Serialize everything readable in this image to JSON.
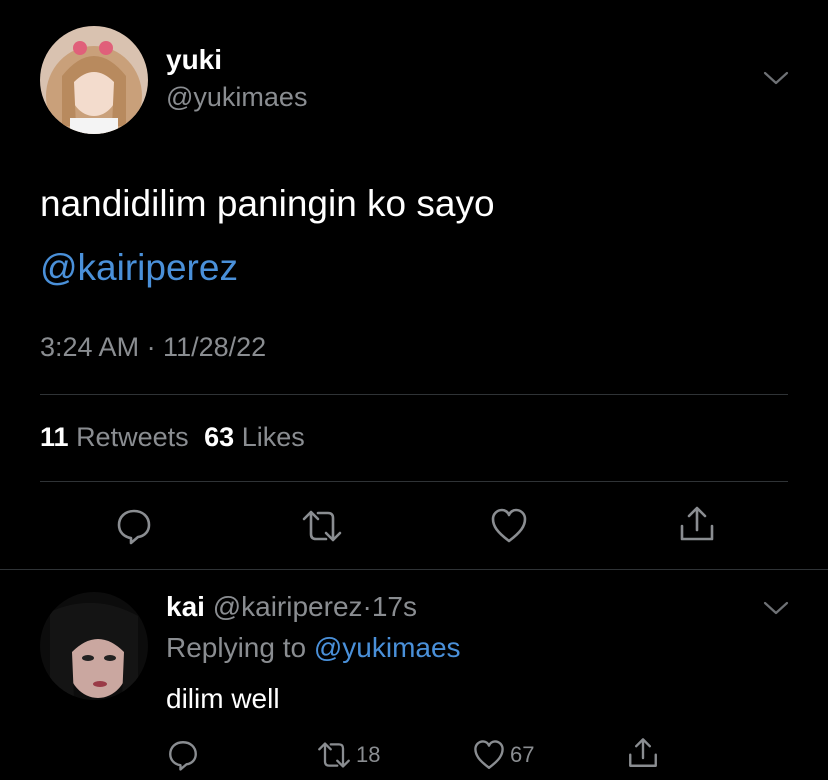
{
  "tweet": {
    "display_name": "yuki",
    "handle": "@yukimaes",
    "text_line1": "nandidilim paningin ko sayo",
    "text_mention": "@kairiperez",
    "timestamp": "3:24 AM · 11/28/22",
    "retweets_count": "11",
    "retweets_label": "Retweets",
    "likes_count": "63",
    "likes_label": "Likes",
    "actions": [
      "reply-icon",
      "retweet-icon",
      "like-icon",
      "share-icon"
    ]
  },
  "reply": {
    "display_name": "kai",
    "handle": "@kairiperez",
    "separator": "·",
    "time": "17s",
    "replying_prefix": "Replying to",
    "replying_mention": "@yukimaes",
    "text": "dilim well",
    "retweets_count": "18",
    "likes_count": "67"
  },
  "colors": {
    "background": "#000000",
    "text": "#ffffff",
    "secondary": "#8a8d91",
    "link": "#4a90d9",
    "divider": "#2f3336"
  }
}
